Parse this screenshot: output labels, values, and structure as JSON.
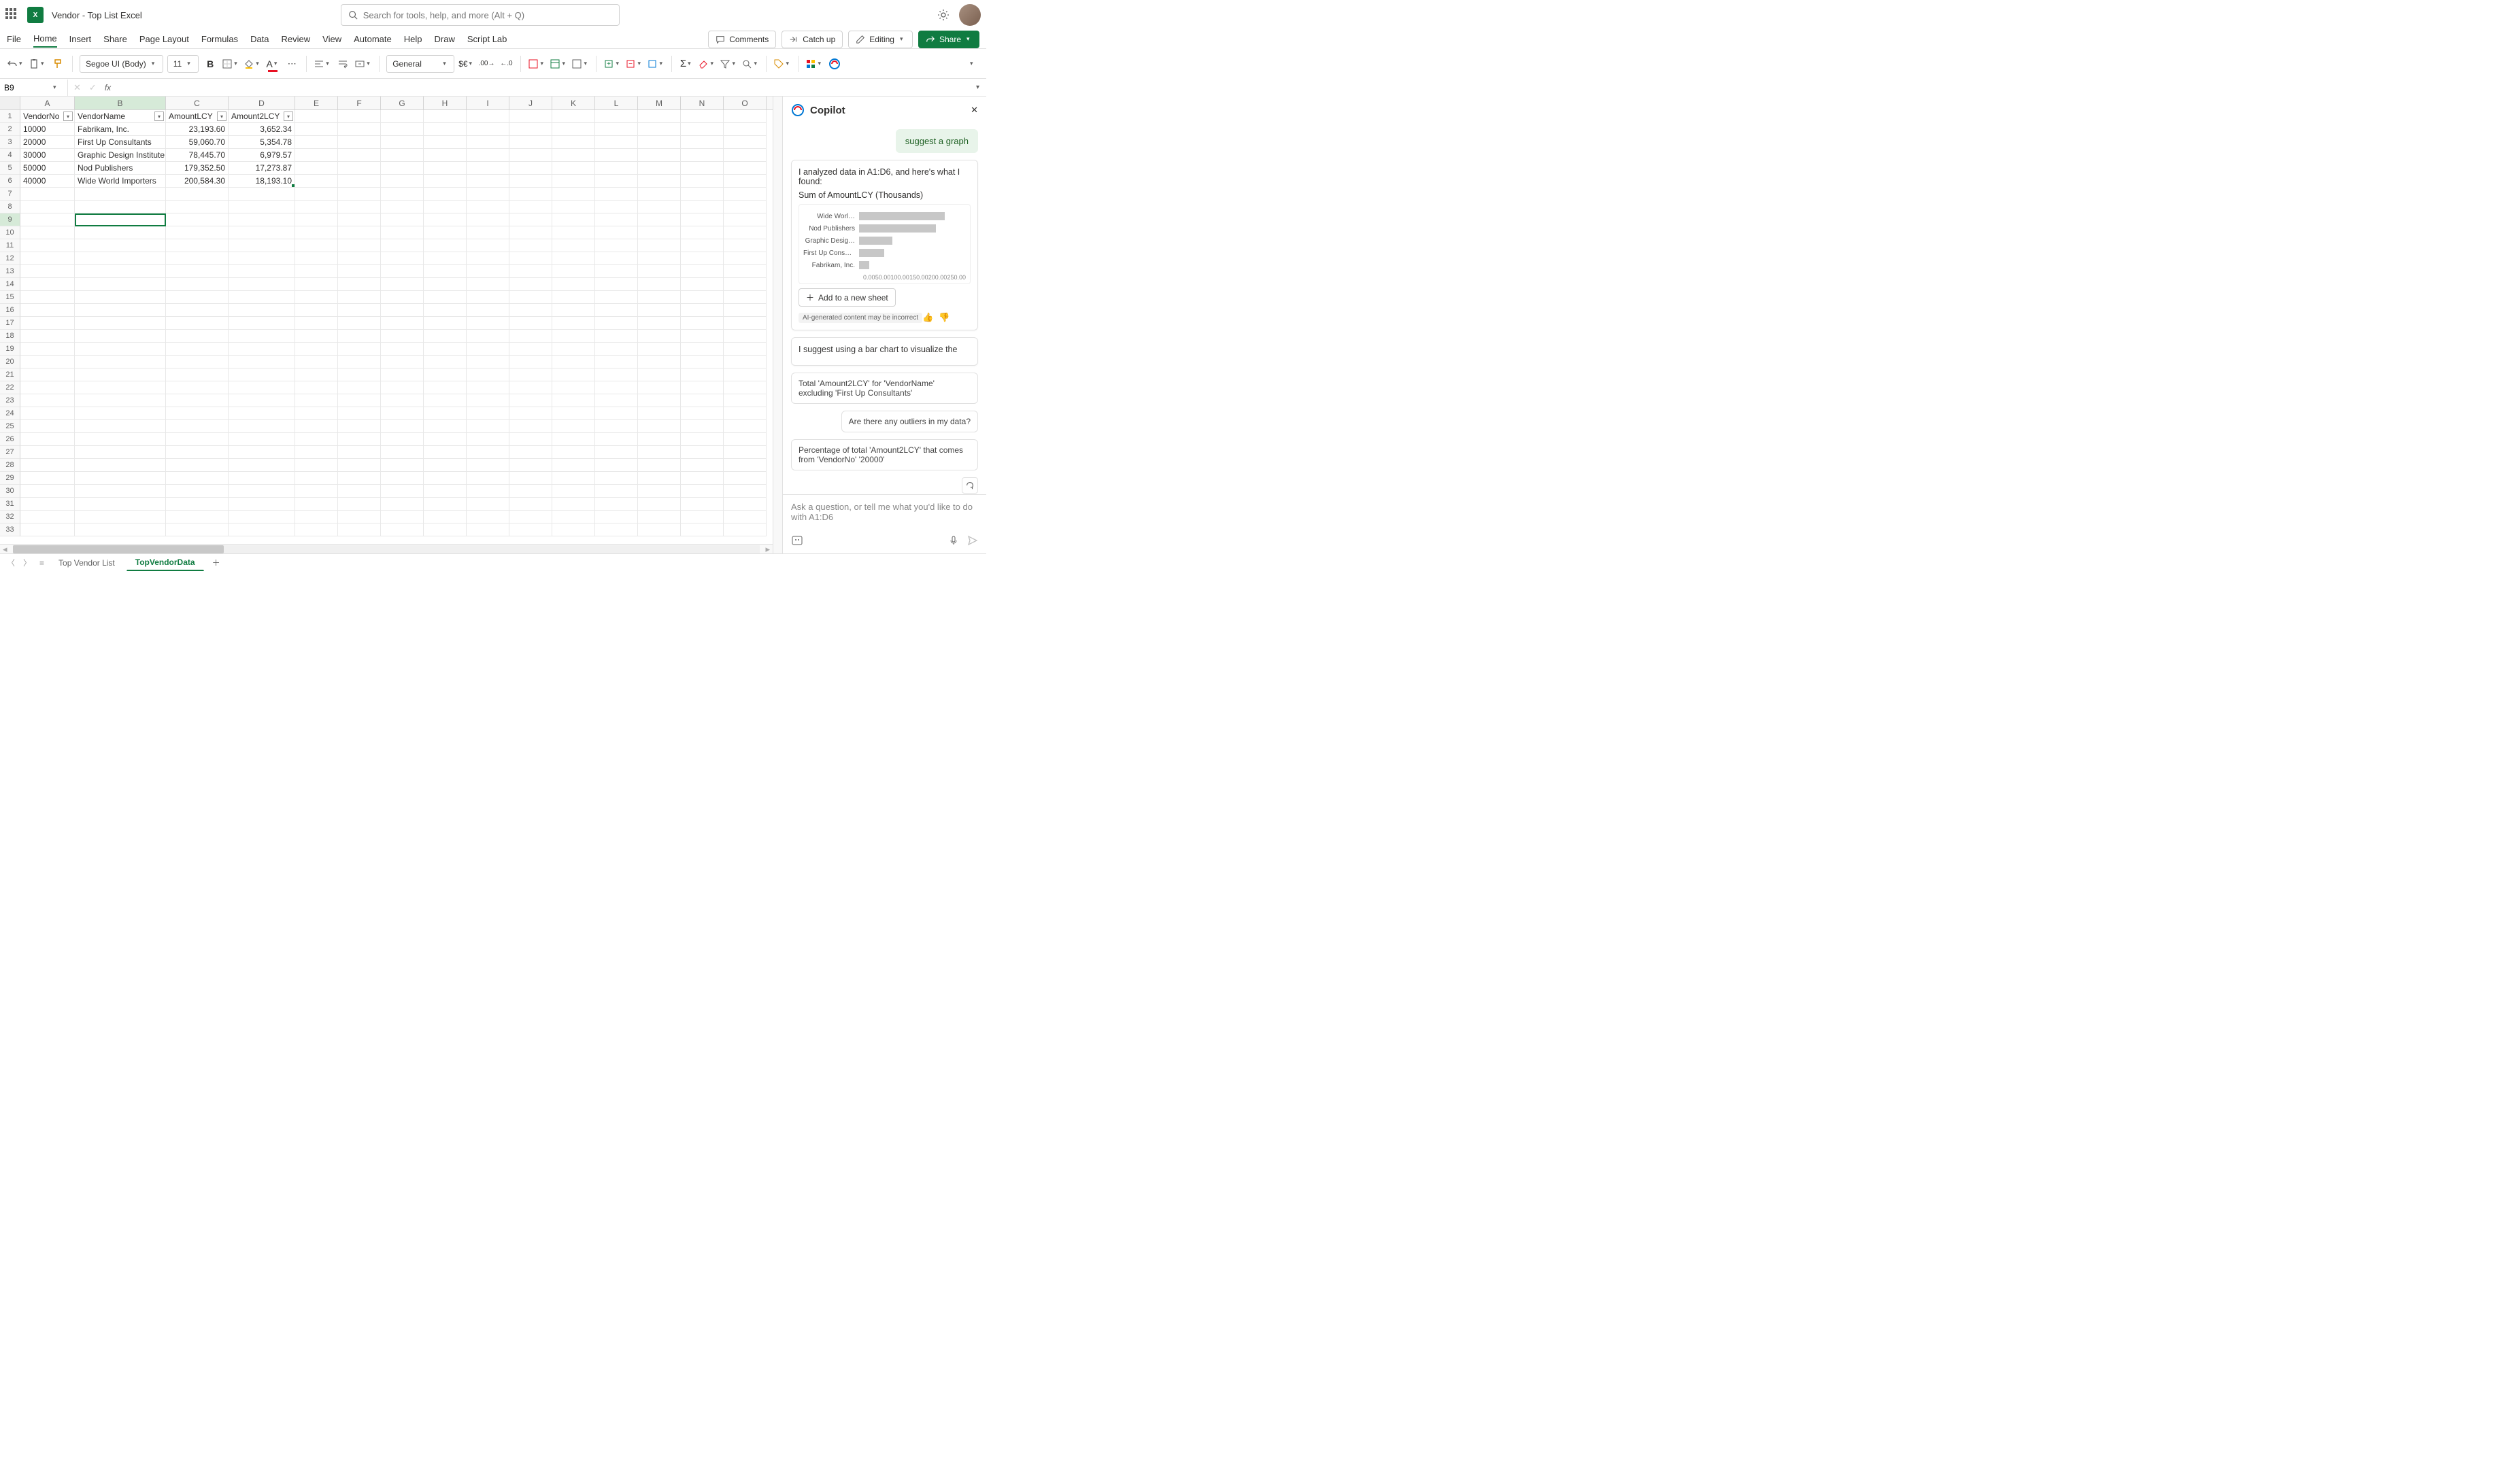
{
  "title_bar": {
    "doc_title": "Vendor - Top List Excel",
    "search_placeholder": "Search for tools, help, and more (Alt + Q)"
  },
  "menu": {
    "tabs": [
      "File",
      "Home",
      "Insert",
      "Share",
      "Page Layout",
      "Formulas",
      "Data",
      "Review",
      "View",
      "Automate",
      "Help",
      "Draw",
      "Script Lab"
    ],
    "active": "Home",
    "comments": "Comments",
    "catch_up": "Catch up",
    "editing": "Editing",
    "share": "Share"
  },
  "ribbon": {
    "font_name": "Segoe UI (Body)",
    "font_size": "11",
    "number_format": "General"
  },
  "name_box": "B9",
  "columns": [
    "A",
    "B",
    "C",
    "D",
    "E",
    "F",
    "G",
    "H",
    "I",
    "J",
    "K",
    "L",
    "M",
    "N",
    "O"
  ],
  "col_widths": {
    "A": 80,
    "B": 134,
    "C": 92,
    "D": 98
  },
  "selected_col_index": 1,
  "selected_row": 9,
  "row_count": 33,
  "table": {
    "headers": [
      "VendorNo",
      "VendorName",
      "AmountLCY",
      "Amount2LCY"
    ],
    "rows": [
      {
        "VendorNo": "10000",
        "VendorName": "Fabrikam, Inc.",
        "AmountLCY": "23,193.60",
        "Amount2LCY": "3,652.34"
      },
      {
        "VendorNo": "20000",
        "VendorName": "First Up Consultants",
        "AmountLCY": "59,060.70",
        "Amount2LCY": "5,354.78"
      },
      {
        "VendorNo": "30000",
        "VendorName": "Graphic Design Institute",
        "AmountLCY": "78,445.70",
        "Amount2LCY": "6,979.57"
      },
      {
        "VendorNo": "50000",
        "VendorName": "Nod Publishers",
        "AmountLCY": "179,352.50",
        "Amount2LCY": "17,273.87"
      },
      {
        "VendorNo": "40000",
        "VendorName": "Wide World Importers",
        "AmountLCY": "200,584.30",
        "Amount2LCY": "18,193.10"
      }
    ]
  },
  "copilot": {
    "title": "Copilot",
    "user_message": "suggest a graph",
    "analysis_intro": "I analyzed data in A1:D6, and here's what I found:",
    "chart_title": "Sum of AmountLCY (Thousands)",
    "add_button": "Add to a new sheet",
    "ai_note": "AI-generated content may be incorrect",
    "followup": "I suggest using a bar chart to visualize the",
    "suggestions": [
      "Total 'Amount2LCY' for 'VendorName' excluding 'First Up Consultants'",
      "Are there any outliers in my data?",
      "Percentage of total 'Amount2LCY' that comes from 'VendorNo' '20000'"
    ],
    "input_placeholder": "Ask a question, or tell me what you'd like to do with A1:D6"
  },
  "chart_data": {
    "type": "bar",
    "orientation": "horizontal",
    "title": "Sum of AmountLCY (Thousands)",
    "xlabel": "",
    "ylabel": "",
    "xlim": [
      0,
      250
    ],
    "x_ticks": [
      "0.00",
      "50.00",
      "100.00",
      "150.00",
      "200.00",
      "250.00"
    ],
    "categories": [
      "Wide Worl…",
      "Nod Publishers",
      "Graphic Desig…",
      "First Up Consultants",
      "Fabrikam, Inc."
    ],
    "values": [
      200.58,
      179.35,
      78.45,
      59.06,
      23.19
    ]
  },
  "sheets": {
    "tabs": [
      "Top Vendor List",
      "TopVendorData"
    ],
    "active": "TopVendorData"
  }
}
